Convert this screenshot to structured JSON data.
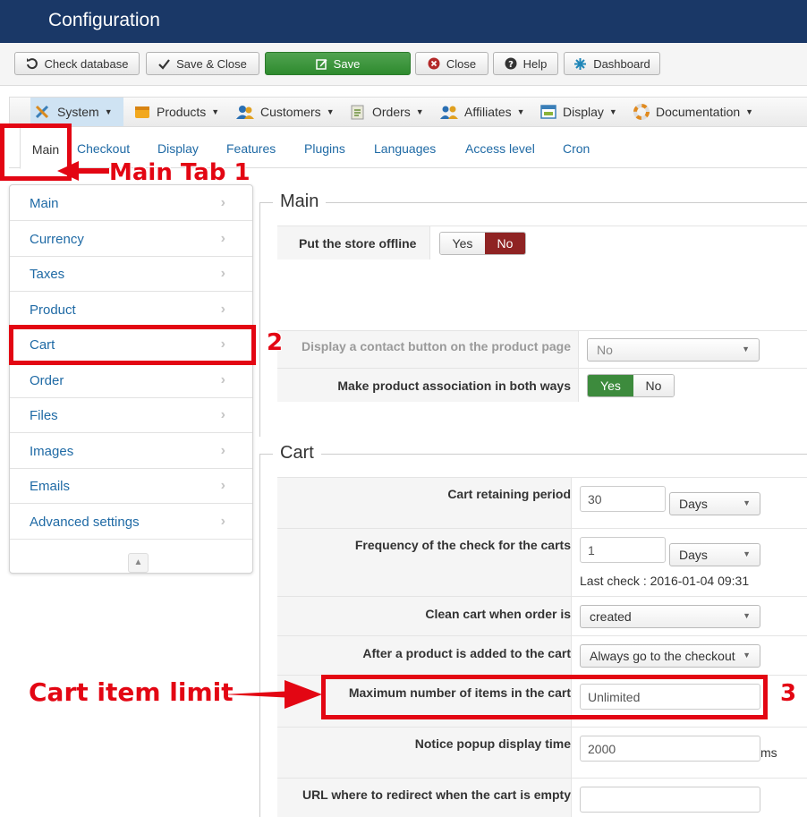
{
  "header": {
    "title": "Configuration"
  },
  "toolbar": {
    "check_database": "Check database",
    "save_close": "Save & Close",
    "save": "Save",
    "close": "Close",
    "help": "Help",
    "dashboard": "Dashboard"
  },
  "menu": {
    "system": "System",
    "products": "Products",
    "customers": "Customers",
    "orders": "Orders",
    "affiliates": "Affiliates",
    "display": "Display",
    "documentation": "Documentation"
  },
  "tabs": [
    "Main",
    "Checkout",
    "Display",
    "Features",
    "Plugins",
    "Languages",
    "Access level",
    "Cron"
  ],
  "sidenav": [
    "Main",
    "Currency",
    "Taxes",
    "Product",
    "Cart",
    "Order",
    "Files",
    "Images",
    "Emails",
    "Advanced settings"
  ],
  "main_section": {
    "legend": "Main",
    "store_offline_label": "Put the store offline",
    "yes": "Yes",
    "no": "No",
    "contact_button_label": "Display a contact button on the product page",
    "contact_button_value": "No",
    "association_label": "Make product association in both ways"
  },
  "cart_section": {
    "legend": "Cart",
    "retaining_label": "Cart retaining period",
    "retaining_value": "30",
    "retaining_unit": "Days",
    "frequency_label": "Frequency of the check for the carts",
    "frequency_value": "1",
    "frequency_unit": "Days",
    "last_check": "Last check : 2016-01-04 09:31",
    "clean_label": "Clean cart when order is",
    "clean_value": "created",
    "after_add_label": "After a product is added to the cart",
    "after_add_value": "Always go to the checkout",
    "max_items_label": "Maximum number of items in the cart",
    "max_items_value": "Unlimited",
    "popup_label": "Notice popup display time",
    "popup_value": "2000",
    "popup_unit": "ms",
    "redirect_label": "URL where to redirect when the cart is empty"
  },
  "annotations": {
    "main_tab": "Main Tab 1",
    "step2": "2",
    "step3": "3",
    "cart_item_limit": "Cart item limit"
  },
  "colors": {
    "header": "#1a3867",
    "annotation": "#e30613",
    "link": "#1f6aa5",
    "offline_no": "#8f2323",
    "assoc_yes": "#3d8b3d"
  }
}
